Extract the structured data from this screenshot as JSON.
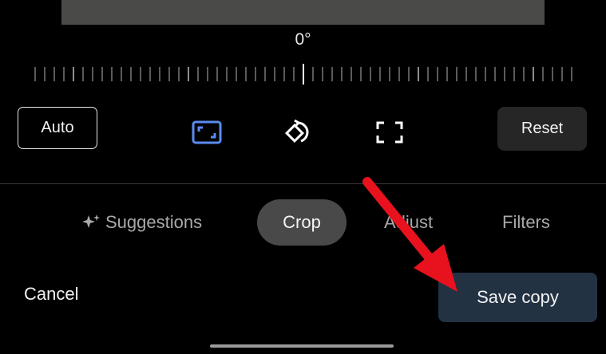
{
  "editor": {
    "angle": "0°",
    "auto_label": "Auto",
    "reset_label": "Reset"
  },
  "tools": [
    {
      "name": "aspect-ratio-icon",
      "color": "#5a8cf0",
      "active": true
    },
    {
      "name": "rotate-icon",
      "color": "#ffffff",
      "active": false
    },
    {
      "name": "free-crop-icon",
      "color": "#ffffff",
      "active": false
    }
  ],
  "tabs": [
    {
      "label": "Suggestions",
      "icon": "sparkle-icon",
      "active": false
    },
    {
      "label": "Crop",
      "active": true
    },
    {
      "label": "Adjust",
      "active": false
    },
    {
      "label": "Filters",
      "active": false
    }
  ],
  "footer": {
    "cancel_label": "Cancel",
    "save_label": "Save copy"
  },
  "colors": {
    "background": "#000000",
    "accent": "#5a8cf0",
    "save_button": "#233243",
    "annotation_arrow": "#e8121e"
  }
}
